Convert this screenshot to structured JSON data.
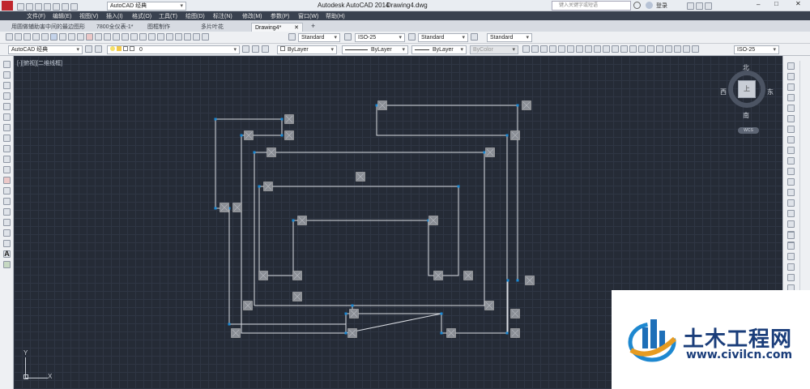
{
  "app": {
    "title": "Autodesk AutoCAD 2014",
    "file": "Drawing4.dwg",
    "quick_access_workspace": "AutoCAD 经典",
    "search_placeholder": "键入关键字或短语",
    "login_label": "登录"
  },
  "menu": [
    "文件(F)",
    "编辑(E)",
    "视图(V)",
    "插入(I)",
    "格式(O)",
    "工具(T)",
    "绘图(D)",
    "标注(N)",
    "修改(M)",
    "参数(P)",
    "窗口(W)",
    "帮助(H)"
  ],
  "tabs": [
    "用圆做辅助害中间的最边图形",
    "7800全仪表-1*",
    "图框制作",
    "多片叶花",
    "Drawing4*"
  ],
  "toolbar": {
    "text_style": "Standard",
    "dim_style": "ISO-25",
    "table_style": "Standard",
    "mleader_style": "Standard",
    "workspace": "AutoCAD 经典",
    "layer": "0",
    "color": "ByLayer",
    "linetype": "ByLayer",
    "lineweight": "ByLayer",
    "plotstyle": "ByColor",
    "right_dim_style": "ISO-25"
  },
  "viewport": {
    "label": "[-][俯视][二维线框]",
    "viewcube": {
      "north": "北",
      "south": "南",
      "east": "东",
      "west": "西",
      "top": "上",
      "wcs": "WCS"
    },
    "ucs_x": "X",
    "ucs_y": "Y"
  },
  "watermark": {
    "title": "土木工程网",
    "url": "www.civilcn.com"
  },
  "colors": {
    "canvas_bg": "#252b36",
    "line": "#d9dce2",
    "grip": "#1a8ad6",
    "selection_box": "#b9b9b9",
    "menubar": "#39414f"
  }
}
